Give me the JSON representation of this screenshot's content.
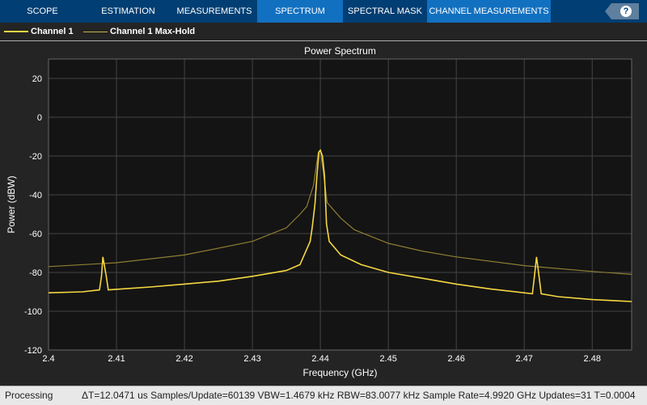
{
  "tabs": [
    {
      "label": "SCOPE"
    },
    {
      "label": "ESTIMATION"
    },
    {
      "label": "MEASUREMENTS"
    },
    {
      "label": "SPECTRUM",
      "active": true
    },
    {
      "label": "SPECTRAL MASK"
    },
    {
      "label": "CHANNEL MEASUREMENTS"
    }
  ],
  "help_icon": "question-mark-icon",
  "legend": [
    {
      "label": "Channel 1",
      "color": "#f5d742"
    },
    {
      "label": "Channel 1 Max-Hold",
      "color": "#c9b24a"
    }
  ],
  "status": {
    "state": "Processing",
    "readout": "ΔT=12.0471 us  Samples/Update=60139  VBW=1.4679 kHz  RBW=83.0077 kHz  Sample Rate=4.9920 GHz  Updates=31  T=0.0004"
  },
  "chart_data": {
    "type": "line",
    "title": "Power Spectrum",
    "xlabel": "Frequency (GHz)",
    "ylabel": "Power (dBW)",
    "xlim": [
      2.4,
      2.4858
    ],
    "ylim": [
      -120,
      30
    ],
    "xticks": [
      "2.4",
      "2.41",
      "2.42",
      "2.43",
      "2.44",
      "2.45",
      "2.46",
      "2.47",
      "2.48"
    ],
    "yticks": [
      "20",
      "0",
      "-20",
      "-40",
      "-60",
      "-80",
      "-100",
      "-120"
    ],
    "grid": true,
    "series": [
      {
        "name": "Channel 1",
        "color": "#f5d742",
        "points": [
          [
            2.4,
            -90.5
          ],
          [
            2.405,
            -90
          ],
          [
            2.4075,
            -89
          ],
          [
            2.4078,
            -82
          ],
          [
            2.408,
            -72
          ],
          [
            2.4082,
            -76
          ],
          [
            2.4085,
            -82
          ],
          [
            2.4088,
            -89
          ],
          [
            2.415,
            -87.5
          ],
          [
            2.42,
            -86
          ],
          [
            2.425,
            -84.5
          ],
          [
            2.43,
            -82
          ],
          [
            2.435,
            -79
          ],
          [
            2.437,
            -76
          ],
          [
            2.4385,
            -64
          ],
          [
            2.4388,
            -57
          ],
          [
            2.4392,
            -45
          ],
          [
            2.4395,
            -30
          ],
          [
            2.4398,
            -18
          ],
          [
            2.44,
            -17
          ],
          [
            2.4403,
            -20
          ],
          [
            2.4406,
            -30
          ],
          [
            2.4409,
            -55
          ],
          [
            2.4413,
            -64
          ],
          [
            2.443,
            -71
          ],
          [
            2.446,
            -76
          ],
          [
            2.45,
            -80
          ],
          [
            2.455,
            -83
          ],
          [
            2.46,
            -86
          ],
          [
            2.465,
            -88.5
          ],
          [
            2.4712,
            -91
          ],
          [
            2.4715,
            -82
          ],
          [
            2.4718,
            -72
          ],
          [
            2.4721,
            -80
          ],
          [
            2.4725,
            -91
          ],
          [
            2.475,
            -92.5
          ],
          [
            2.48,
            -94
          ],
          [
            2.4858,
            -95
          ]
        ]
      },
      {
        "name": "Channel 1 Max-Hold",
        "color": "#8f7e34",
        "points": [
          [
            2.4,
            -77
          ],
          [
            2.41,
            -75
          ],
          [
            2.42,
            -71
          ],
          [
            2.43,
            -64
          ],
          [
            2.435,
            -57
          ],
          [
            2.437,
            -50
          ],
          [
            2.438,
            -46
          ],
          [
            2.439,
            -35
          ],
          [
            2.4397,
            -18
          ],
          [
            2.44,
            -17
          ],
          [
            2.4405,
            -30
          ],
          [
            2.441,
            -44
          ],
          [
            2.443,
            -52
          ],
          [
            2.445,
            -58
          ],
          [
            2.45,
            -65
          ],
          [
            2.455,
            -69
          ],
          [
            2.46,
            -72
          ],
          [
            2.47,
            -76.5
          ],
          [
            2.48,
            -79.5
          ],
          [
            2.4858,
            -81
          ]
        ]
      }
    ]
  }
}
